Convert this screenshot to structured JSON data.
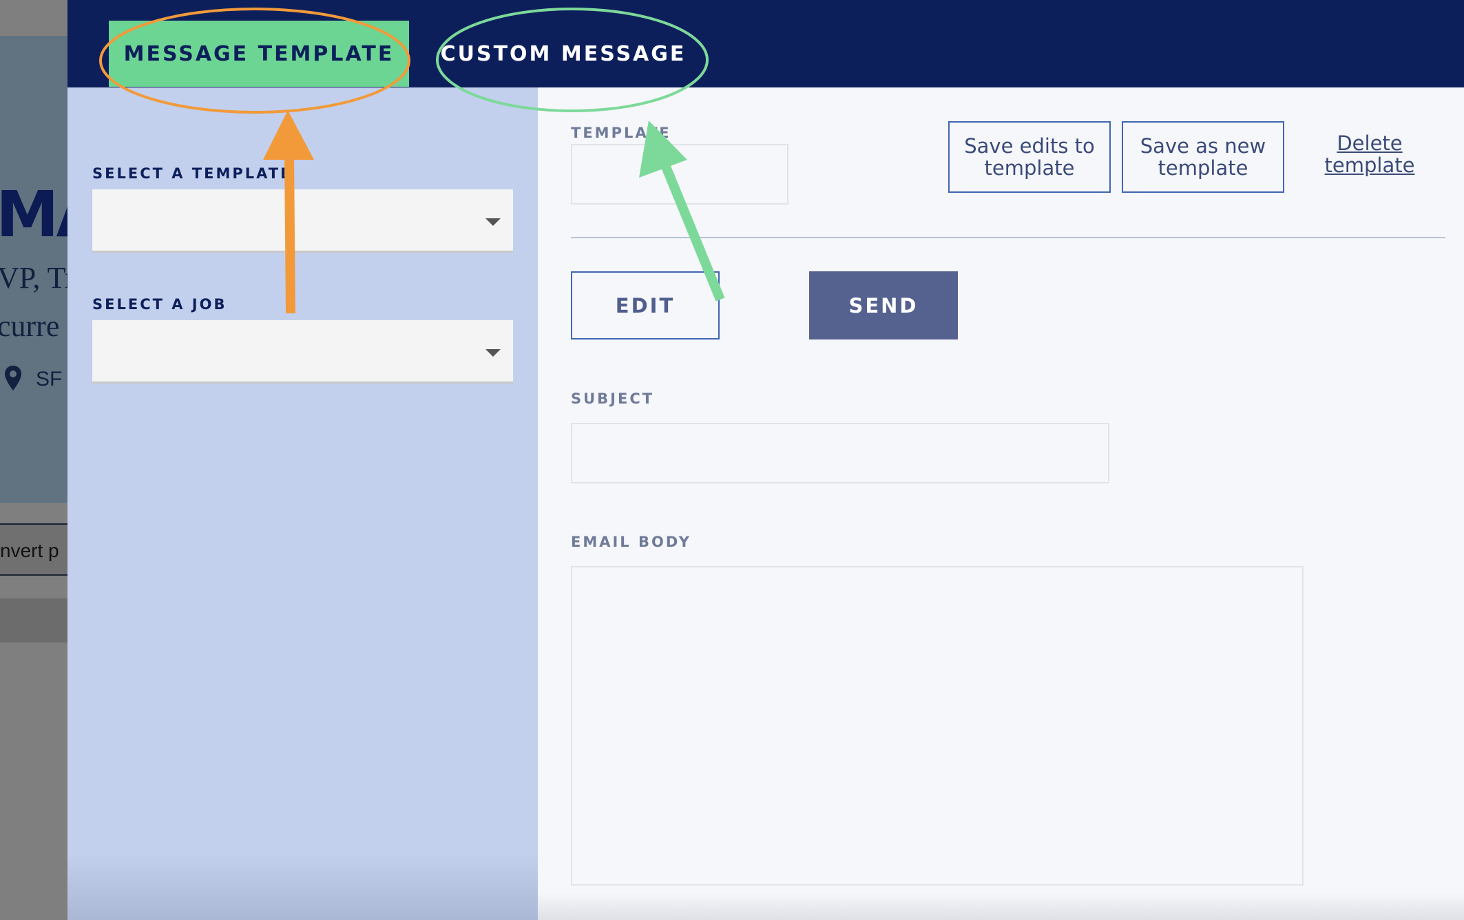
{
  "background_page": {
    "heading_fragment": "MA",
    "subtitle_fragment": "VP, Tr",
    "line2_fragment": "curre",
    "location_fragment": "SF",
    "convert_button_fragment": "nvert p"
  },
  "tabs": [
    {
      "label": "MESSAGE TEMPLATE",
      "active": true
    },
    {
      "label": "CUSTOM MESSAGE",
      "active": false
    }
  ],
  "left_panel": {
    "select_template_label": "SELECT A TEMPLATE",
    "select_template_value": "",
    "select_job_label": "SELECT A JOB",
    "select_job_value": ""
  },
  "right_panel": {
    "template_label": "TEMPLATE",
    "template_value": "",
    "save_edits_label": "Save edits to template",
    "save_new_label": "Save as new template",
    "delete_label": "Delete template",
    "edit_label": "EDIT",
    "send_label": "SEND",
    "subject_label": "SUBJECT",
    "subject_value": "",
    "email_body_label": "EMAIL BODY",
    "email_body_value": ""
  },
  "colors": {
    "topbar": "#0d1f5b",
    "active_tab": "#6dd593",
    "left_panel": "#c2d0ed",
    "send_button": "#55628f",
    "annotation_orange": "#f29a3a",
    "annotation_green": "#7dd99a"
  },
  "icons": {
    "select_caret": "caret-down-icon",
    "location": "map-pin-icon"
  }
}
